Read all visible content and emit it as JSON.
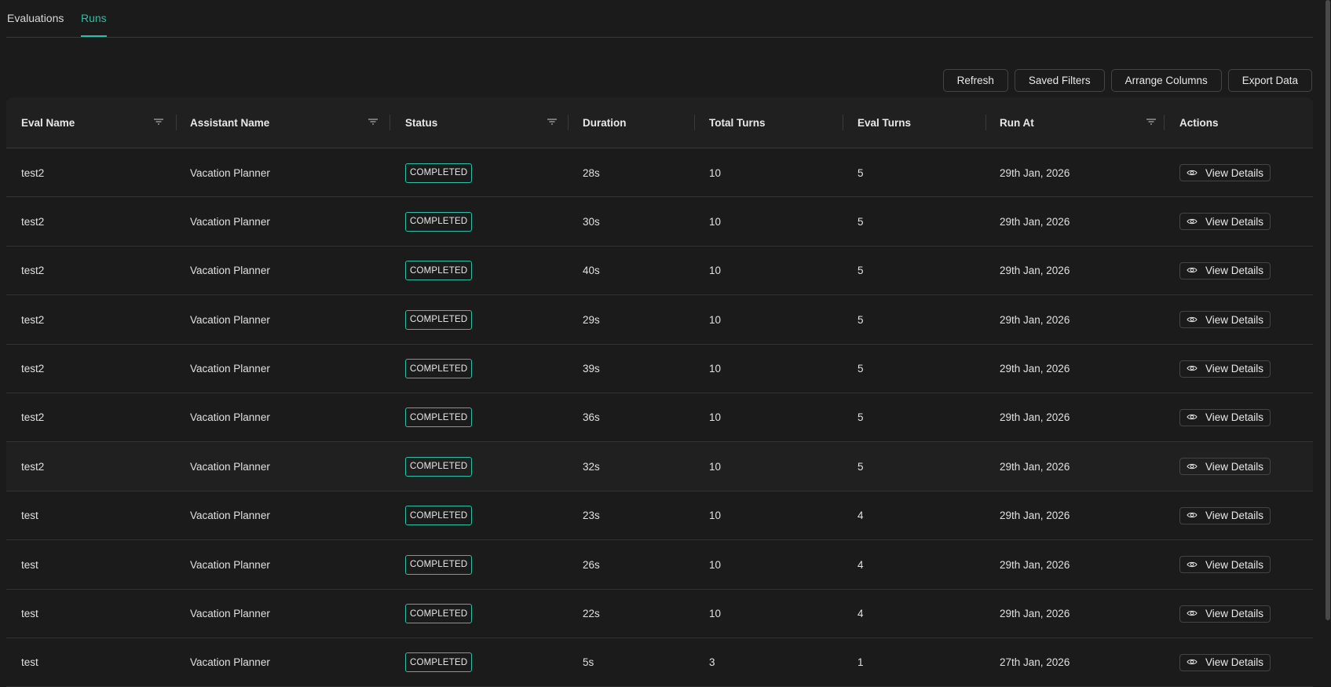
{
  "tabs": [
    {
      "label": "Evaluations",
      "active": false
    },
    {
      "label": "Runs",
      "active": true
    }
  ],
  "toolbar": {
    "refresh": "Refresh",
    "saved_filters": "Saved Filters",
    "arrange_columns": "Arrange Columns",
    "export_data": "Export Data"
  },
  "columns": [
    "Eval Name",
    "Assistant Name",
    "Status",
    "Duration",
    "Total Turns",
    "Eval Turns",
    "Run At",
    "Actions"
  ],
  "action_label": "View Details",
  "accent_color": "#2bbfa4",
  "rows": [
    {
      "eval": "test2",
      "assistant": "Vacation Planner",
      "status": "COMPLETED",
      "duration": "28s",
      "total": "10",
      "evalturns": "5",
      "runat": "29th Jan, 2026"
    },
    {
      "eval": "test2",
      "assistant": "Vacation Planner",
      "status": "COMPLETED",
      "duration": "30s",
      "total": "10",
      "evalturns": "5",
      "runat": "29th Jan, 2026"
    },
    {
      "eval": "test2",
      "assistant": "Vacation Planner",
      "status": "COMPLETED",
      "duration": "40s",
      "total": "10",
      "evalturns": "5",
      "runat": "29th Jan, 2026"
    },
    {
      "eval": "test2",
      "assistant": "Vacation Planner",
      "status": "COMPLETED",
      "duration": "29s",
      "total": "10",
      "evalturns": "5",
      "runat": "29th Jan, 2026"
    },
    {
      "eval": "test2",
      "assistant": "Vacation Planner",
      "status": "COMPLETED",
      "duration": "39s",
      "total": "10",
      "evalturns": "5",
      "runat": "29th Jan, 2026"
    },
    {
      "eval": "test2",
      "assistant": "Vacation Planner",
      "status": "COMPLETED",
      "duration": "36s",
      "total": "10",
      "evalturns": "5",
      "runat": "29th Jan, 2026"
    },
    {
      "eval": "test2",
      "assistant": "Vacation Planner",
      "status": "COMPLETED",
      "duration": "32s",
      "total": "10",
      "evalturns": "5",
      "runat": "29th Jan, 2026"
    },
    {
      "eval": "test",
      "assistant": "Vacation Planner",
      "status": "COMPLETED",
      "duration": "23s",
      "total": "10",
      "evalturns": "4",
      "runat": "29th Jan, 2026"
    },
    {
      "eval": "test",
      "assistant": "Vacation Planner",
      "status": "COMPLETED",
      "duration": "26s",
      "total": "10",
      "evalturns": "4",
      "runat": "29th Jan, 2026"
    },
    {
      "eval": "test",
      "assistant": "Vacation Planner",
      "status": "COMPLETED",
      "duration": "22s",
      "total": "10",
      "evalturns": "4",
      "runat": "29th Jan, 2026"
    },
    {
      "eval": "test",
      "assistant": "Vacation Planner",
      "status": "COMPLETED",
      "duration": "5s",
      "total": "3",
      "evalturns": "1",
      "runat": "27th Jan, 2026"
    }
  ]
}
